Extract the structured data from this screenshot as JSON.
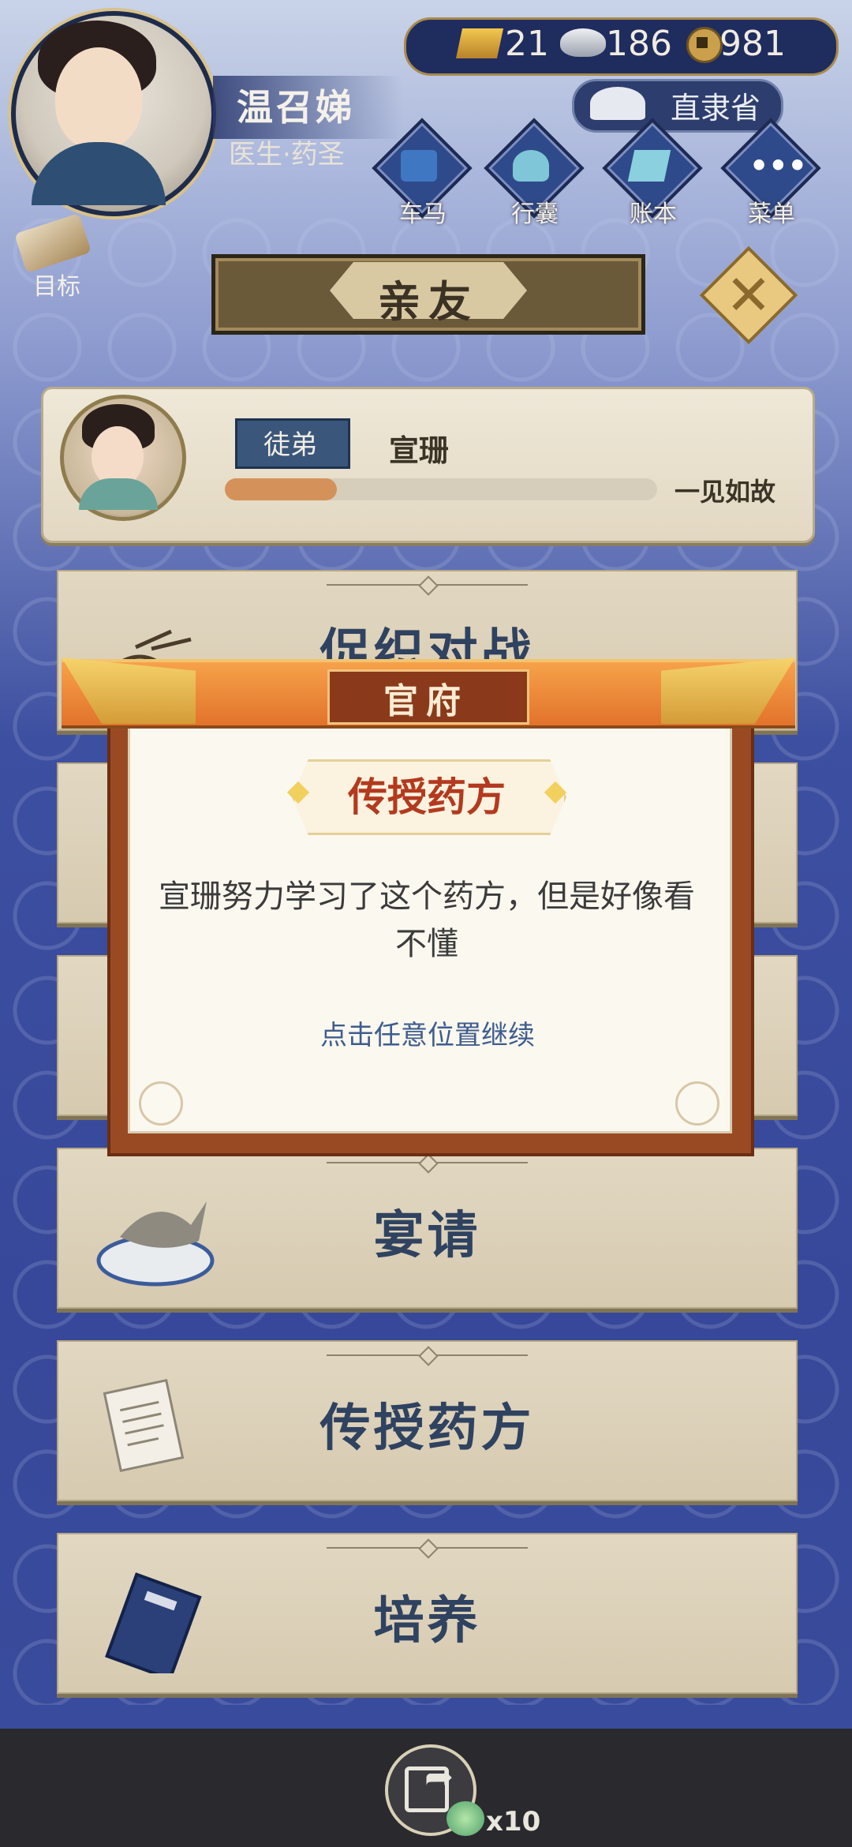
{
  "player": {
    "name": "温召娣",
    "title": "医生·药圣"
  },
  "resources": {
    "gold": "21",
    "silver": "186",
    "coins": "981"
  },
  "location": {
    "label": "直隶省"
  },
  "nav": [
    {
      "label": "车马",
      "icon": "carriage-icon"
    },
    {
      "label": "行囊",
      "icon": "bag-icon"
    },
    {
      "label": "账本",
      "icon": "ledger-icon"
    },
    {
      "label": "菜单",
      "icon": "menu-dots-icon"
    }
  ],
  "goal": {
    "label": "目标"
  },
  "screen_title": "亲友",
  "friend": {
    "role": "徒弟",
    "name": "宣珊",
    "relation": "一见如故",
    "progress": 0.26
  },
  "menu": [
    {
      "label": "促织对战",
      "icon": "cricket-icon"
    },
    {
      "label": "",
      "icon": "unknown-icon"
    },
    {
      "label": "",
      "icon": "unknown-icon"
    },
    {
      "label": "宴请",
      "icon": "banquet-fish-icon"
    },
    {
      "label": "传授药方",
      "icon": "prescription-paper-icon"
    },
    {
      "label": "培养",
      "icon": "book-icon"
    }
  ],
  "bottom": {
    "multiplier": "x10"
  },
  "modal": {
    "header": "官府",
    "subtitle": "传授药方",
    "message": "宣珊努力学习了这个药方，但是好像看不懂",
    "hint": "点击任意位置继续"
  },
  "colors": {
    "accent": "#e2732b",
    "panel_text": "#2f4260",
    "alert_text": "#b33a1f",
    "hint_text": "#3f5d8c"
  }
}
